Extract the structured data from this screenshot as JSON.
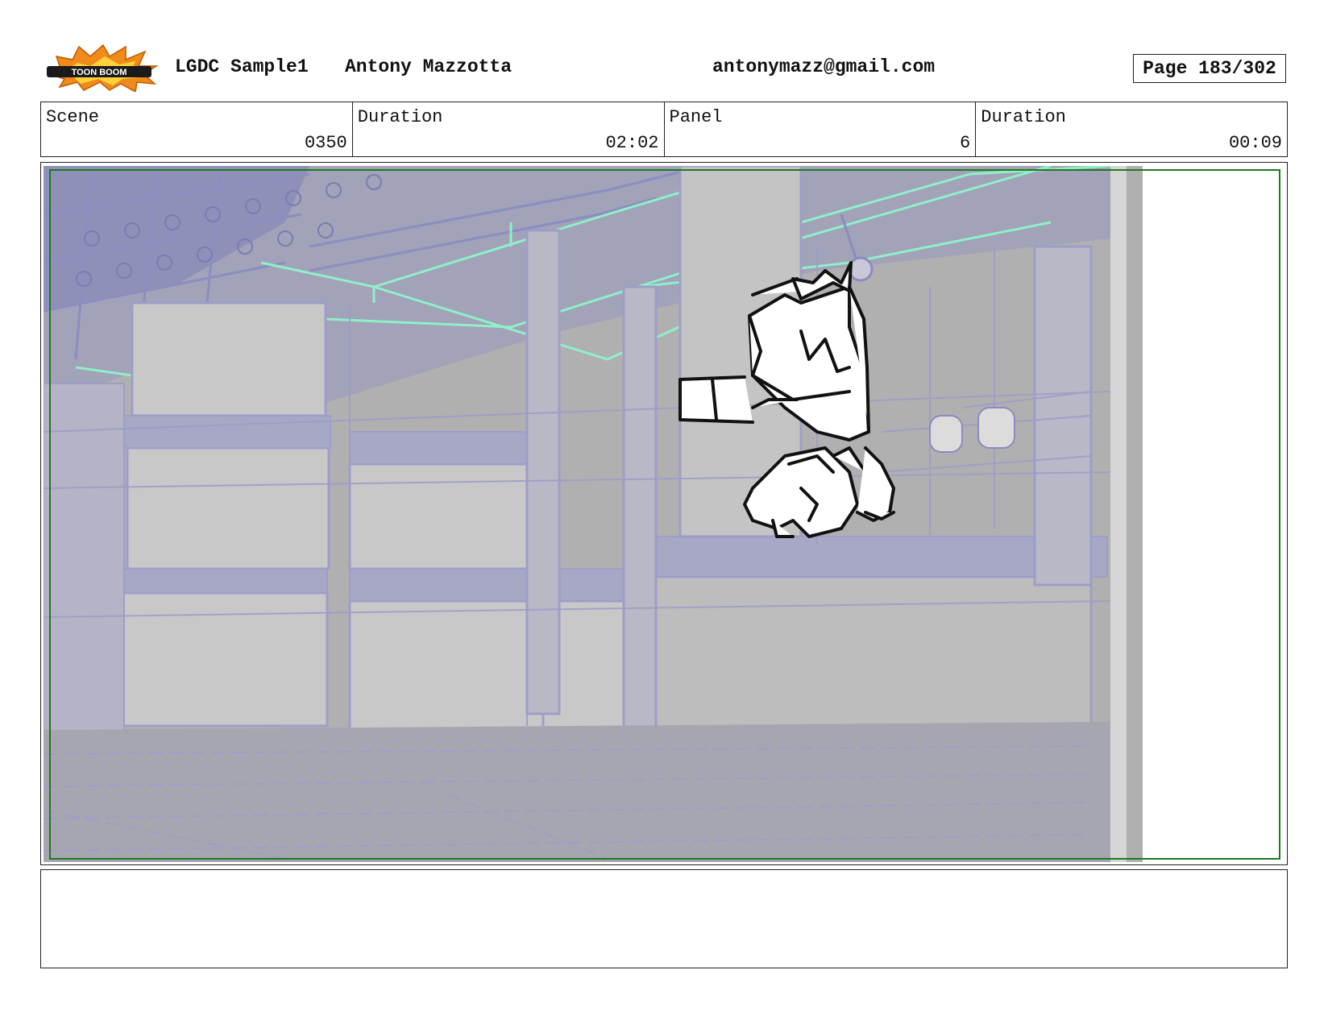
{
  "header": {
    "logo_text": "TOON BOOM",
    "project": "LGDC Sample1",
    "author": "Antony Mazzotta",
    "email": "antonymazz@gmail.com",
    "page": "Page 183/302"
  },
  "info": {
    "scene_label": "Scene",
    "scene_value": "0350",
    "scene_duration_label": "Duration",
    "scene_duration_value": "02:02",
    "panel_label": "Panel",
    "panel_value": "6",
    "panel_duration_label": "Duration",
    "panel_duration_value": "00:09"
  },
  "caption": {
    "text": ""
  },
  "colors": {
    "frame": "#222222",
    "safe_frame": "#1e7a1e",
    "wireframe": "#9d9ec8",
    "highlight": "#8ff0c8",
    "gray_fill": "#b4b4b4",
    "logo_orange": "#f08a1a"
  }
}
